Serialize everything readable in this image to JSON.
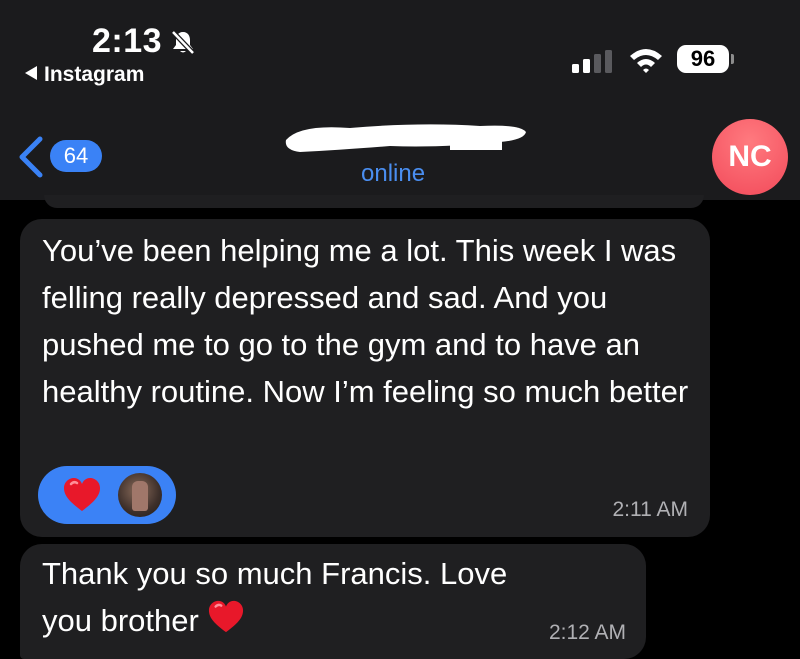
{
  "status_bar": {
    "time": "2:13",
    "back_app": "Instagram",
    "battery": "96"
  },
  "chat_header": {
    "unread_count": "64",
    "presence": "online",
    "avatar_initials": "NC"
  },
  "messages": [
    {
      "text": "You’ve been helping me a lot. This week I was felling really depressed and sad. And you pushed me to go to the gym and to have an healthy routine. Now I’m feeling so much better",
      "time": "2:11 AM",
      "reaction": "heart-icon"
    },
    {
      "text": "Thank you so much Francis. Love you brother",
      "time": "2:12 AM"
    }
  ],
  "colors": {
    "accent": "#3b82f6",
    "avatar": "#f24a5a",
    "bubble": "#1f1f21",
    "header": "#1b1b1d"
  }
}
